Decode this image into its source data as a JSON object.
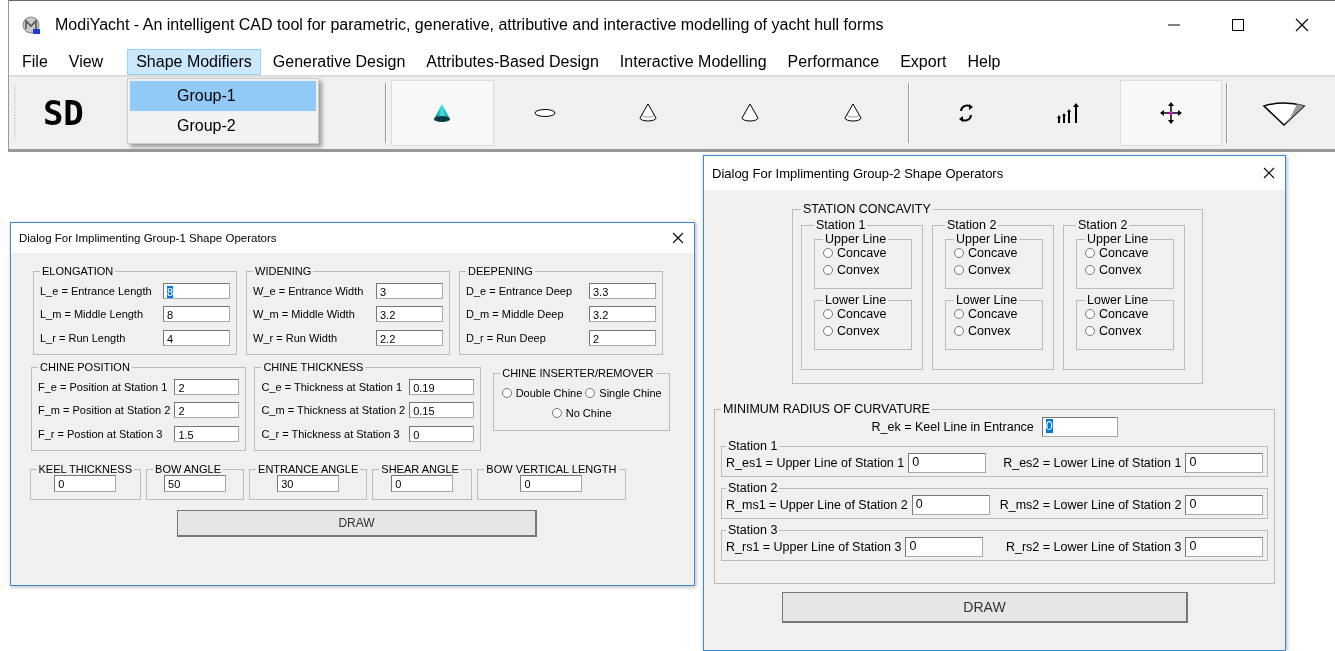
{
  "window": {
    "title": "ModiYacht - An intelligent CAD tool for parametric, generative, attributive and interactive modelling of yacht hull forms"
  },
  "menu": [
    {
      "label": "File",
      "selected": false
    },
    {
      "label": "View",
      "selected": false
    },
    {
      "label": "Shape Modifiers",
      "selected": true
    },
    {
      "label": "Generative Design",
      "selected": false
    },
    {
      "label": "Attributes-Based Design",
      "selected": false
    },
    {
      "label": "Interactive Modelling",
      "selected": false
    },
    {
      "label": "Performance",
      "selected": false
    },
    {
      "label": "Export",
      "selected": false
    },
    {
      "label": "Help",
      "selected": false
    }
  ],
  "dropdown": [
    {
      "label": "Group-1",
      "selected": true
    },
    {
      "label": "Group-2",
      "selected": false
    }
  ],
  "toolbar": {
    "logo": "SD",
    "groups": [
      [
        {
          "kind": "cone-solid",
          "pressed": true
        },
        {
          "kind": "ellipse",
          "pressed": false
        },
        {
          "kind": "cone-lined",
          "pressed": false
        },
        {
          "kind": "cone",
          "pressed": false
        },
        {
          "kind": "cone-lined",
          "pressed": false
        }
      ],
      [
        {
          "kind": "rotate",
          "pressed": false
        },
        {
          "kind": "bars",
          "pressed": false
        },
        {
          "kind": "move",
          "pressed": true
        }
      ],
      [
        {
          "kind": "wedge",
          "pressed": false
        }
      ]
    ]
  },
  "dialog_1": {
    "title": "Dialog For Implimenting Group-1 Shape Operators",
    "row_1": [
      {
        "title": "ELONGATION",
        "fields": [
          {
            "label": "L_e = Entrance Length",
            "value": "8",
            "focused": true
          },
          {
            "label": "L_m = Middle Length",
            "value": "8",
            "focused": false
          },
          {
            "label": "L_r = Run Length",
            "value": "4",
            "focused": false
          }
        ]
      },
      {
        "title": "WIDENING",
        "fields": [
          {
            "label": "W_e = Entrance Width",
            "value": "3",
            "focused": false
          },
          {
            "label": "W_m = Middle Width",
            "value": "3.2",
            "focused": false
          },
          {
            "label": "W_r = Run Width",
            "value": "2.2",
            "focused": false
          }
        ]
      },
      {
        "title": "DEEPENING",
        "fields": [
          {
            "label": "D_e = Entrance Deep",
            "value": "3.3",
            "focused": false
          },
          {
            "label": "D_m = Middle Deep",
            "value": "3.2",
            "focused": false
          },
          {
            "label": "D_r = Run Deep",
            "value": "2",
            "focused": false
          }
        ]
      }
    ],
    "row_2": [
      {
        "title": "CHINE POSITION",
        "fields": [
          {
            "label": "F_e = Position at Station 1",
            "value": "2",
            "focused": false
          },
          {
            "label": "F_m = Position at Station 2",
            "value": "2",
            "focused": false
          },
          {
            "label": "F_r = Postion at Station 3",
            "value": "1.5",
            "focused": false
          }
        ]
      },
      {
        "title": "CHINE THICKNESS",
        "fields": [
          {
            "label": "C_e = Thickness at Station 1",
            "value": "0.19",
            "focused": false
          },
          {
            "label": "C_m = Thickness at Station 2",
            "value": "0.15",
            "focused": false
          },
          {
            "label": "C_r = Thickness at Station 3",
            "value": "0",
            "focused": false
          }
        ]
      }
    ],
    "chine_inserter": {
      "title": "CHINE INSERTER/REMOVER",
      "options": [
        {
          "label": "Double Chine",
          "checked": false
        },
        {
          "label": "Single Chine",
          "checked": false
        },
        {
          "label": "No Chine",
          "checked": false
        }
      ]
    },
    "small_groups": [
      {
        "title": "KEEL THICKNESS",
        "value": "0"
      },
      {
        "title": "BOW ANGLE",
        "value": "50"
      },
      {
        "title": "ENTRANCE ANGLE",
        "value": "30"
      },
      {
        "title": "SHEAR ANGLE",
        "value": "0"
      },
      {
        "title": "BOW VERTICAL LENGTH",
        "value": "0"
      }
    ],
    "button": "DRAW"
  },
  "dialog_2": {
    "title": "Dialog For Implimenting Group-2 Shape Operators",
    "concavity": {
      "title": "STATION CONCAVITY",
      "stations": [
        {
          "title": "Station 1",
          "lines": [
            {
              "title": "Upper Line",
              "options": [
                {
                  "label": "Concave",
                  "checked": false
                },
                {
                  "label": "Convex",
                  "checked": false
                }
              ]
            },
            {
              "title": "Lower Line",
              "options": [
                {
                  "label": "Concave",
                  "checked": false
                },
                {
                  "label": "Convex",
                  "checked": false
                }
              ]
            }
          ]
        },
        {
          "title": "Station 2",
          "lines": [
            {
              "title": "Upper Line",
              "options": [
                {
                  "label": "Concave",
                  "checked": false
                },
                {
                  "label": "Convex",
                  "checked": false
                }
              ]
            },
            {
              "title": "Lower Line",
              "options": [
                {
                  "label": "Concave",
                  "checked": false
                },
                {
                  "label": "Convex",
                  "checked": false
                }
              ]
            }
          ]
        },
        {
          "title": "Station 2",
          "lines": [
            {
              "title": "Upper Line",
              "options": [
                {
                  "label": "Concave",
                  "checked": false
                },
                {
                  "label": "Convex",
                  "checked": false
                }
              ]
            },
            {
              "title": "Lower Line",
              "options": [
                {
                  "label": "Concave",
                  "checked": false
                },
                {
                  "label": "Convex",
                  "checked": false
                }
              ]
            }
          ]
        }
      ]
    },
    "radius": {
      "title": "MINIMUM RADIUS OF CURVATURE",
      "keel": {
        "label": "R_ek = Keel Line in Entrance",
        "value": "0",
        "focused": true
      },
      "stations": [
        {
          "title": "Station 1",
          "fields": [
            {
              "label": "R_es1 = Upper Line of Station 1",
              "value": "0",
              "focused": false
            },
            {
              "label": "R_es2 = Lower Line of Station 1",
              "value": "0",
              "focused": false
            }
          ]
        },
        {
          "title": "Station 2",
          "fields": [
            {
              "label": "R_ms1 = Upper Line of Station 2",
              "value": "0",
              "focused": false
            },
            {
              "label": "R_ms2 = Lower Line of Station 2",
              "value": "0",
              "focused": false
            }
          ]
        },
        {
          "title": "Station 3",
          "fields": [
            {
              "label": "R_rs1 = Upper Line of Station 3",
              "value": "0",
              "focused": false
            },
            {
              "label": "R_rs2 = Lower Line of Station 3",
              "value": "0",
              "focused": false
            }
          ]
        }
      ]
    },
    "button": "DRAW"
  }
}
